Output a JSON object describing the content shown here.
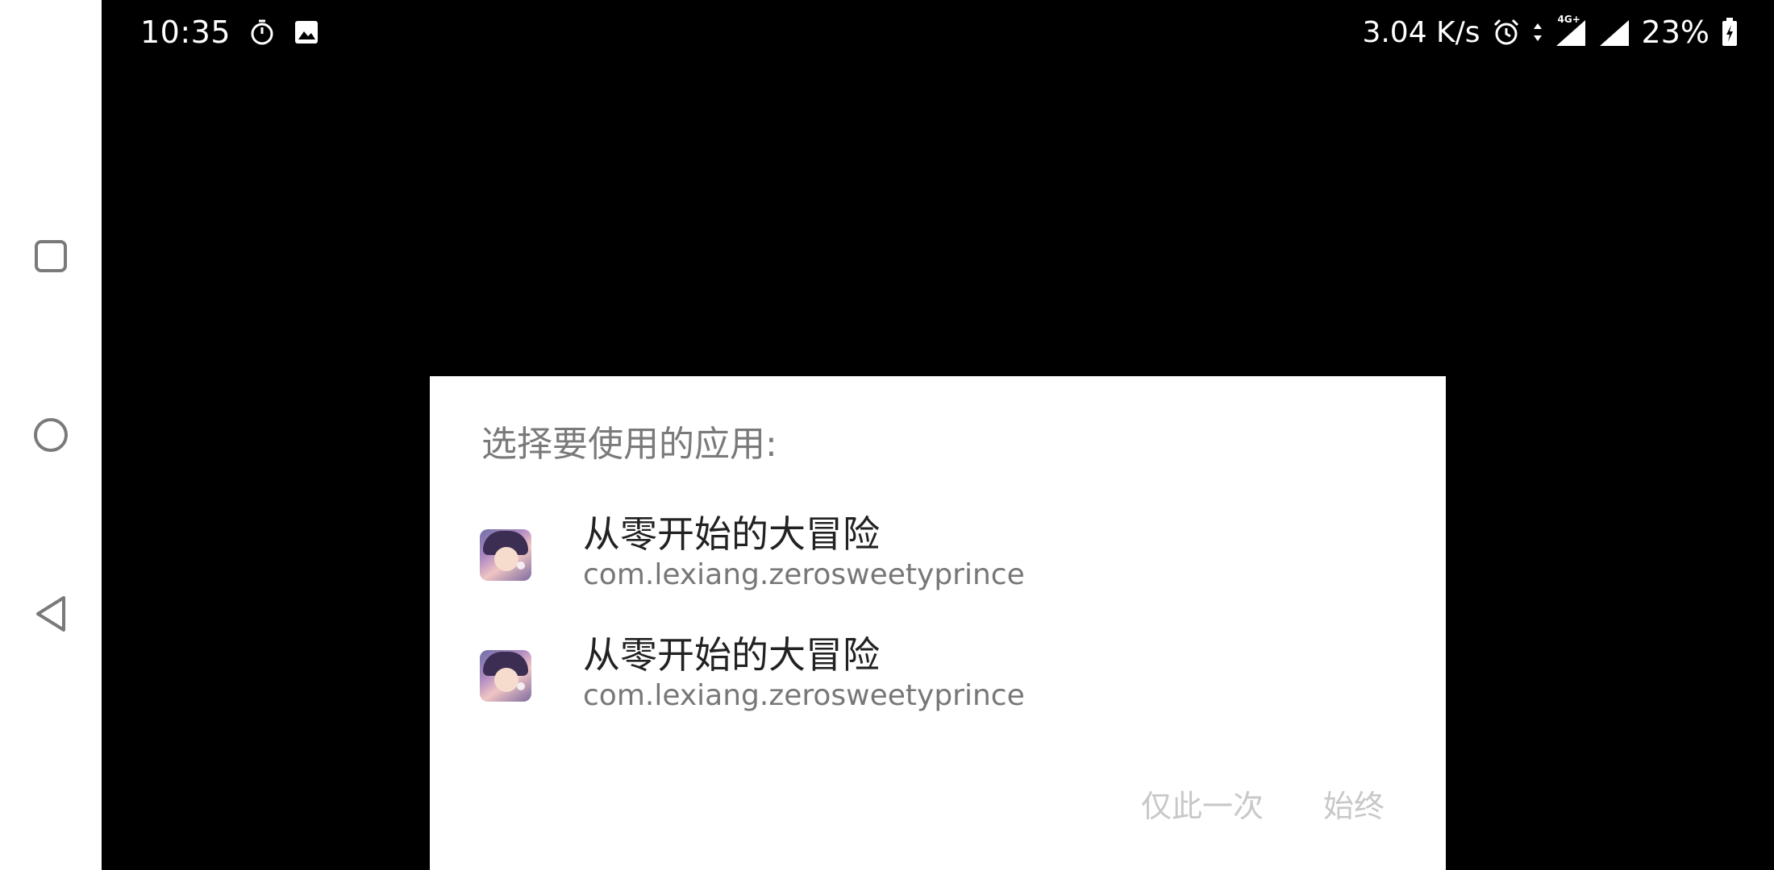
{
  "status_bar": {
    "time": "10:35",
    "network_speed": "3.04 K/s",
    "network_type": "4G+",
    "battery": "23%",
    "left_icons": [
      "timer-icon",
      "image-icon"
    ],
    "right_icons": [
      "alarm-icon",
      "data-arrows-icon",
      "signal-icon",
      "signal-icon",
      "battery-charging-icon"
    ]
  },
  "nav_bar": {
    "items": [
      "recents-icon",
      "home-icon",
      "back-icon"
    ]
  },
  "dialog": {
    "title": "选择要使用的应用:",
    "apps": [
      {
        "name": "从零开始的大冒险",
        "package": "com.lexiang.zerosweetyprince"
      },
      {
        "name": "从零开始的大冒险",
        "package": "com.lexiang.zerosweetyprince"
      }
    ],
    "buttons": {
      "once": "仅此一次",
      "always": "始终"
    }
  },
  "colors": {
    "background": "#000000",
    "dialog": "#ffffff",
    "disabled_button": "#c8c8c8"
  }
}
